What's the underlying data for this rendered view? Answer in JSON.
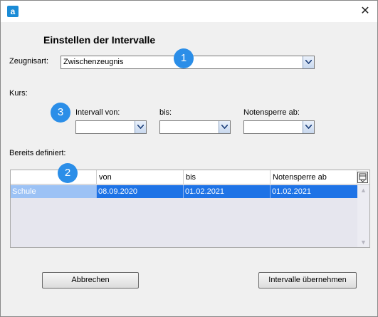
{
  "window": {
    "app_icon": "a",
    "close_glyph": "✕",
    "heading": "Einstellen der Intervalle"
  },
  "form": {
    "zeugnisart_label": "Zeugnisart:",
    "zeugnisart_value": "Zwischenzeugnis",
    "kurs_label": "Kurs:",
    "intervall_von_label": "Intervall von:",
    "intervall_von_value": "",
    "bis_label": "bis:",
    "bis_value": "",
    "notensperre_label": "Notensperre ab:",
    "notensperre_value": "",
    "defined_label": "Bereits definiert:"
  },
  "badges": [
    "1",
    "2",
    "3"
  ],
  "table": {
    "headers": [
      "",
      "von",
      "bis",
      "Notensperre ab"
    ],
    "rows": [
      [
        "Schule",
        "08.09.2020",
        "01.02.2021",
        "01.02.2021"
      ]
    ],
    "column_chooser_icon": "column-chooser-icon"
  },
  "buttons": {
    "cancel": "Abbrechen",
    "apply": "Intervalle übernehmen"
  },
  "colors": {
    "badge": "#2b8ee8",
    "selection": "#1e73e6"
  }
}
